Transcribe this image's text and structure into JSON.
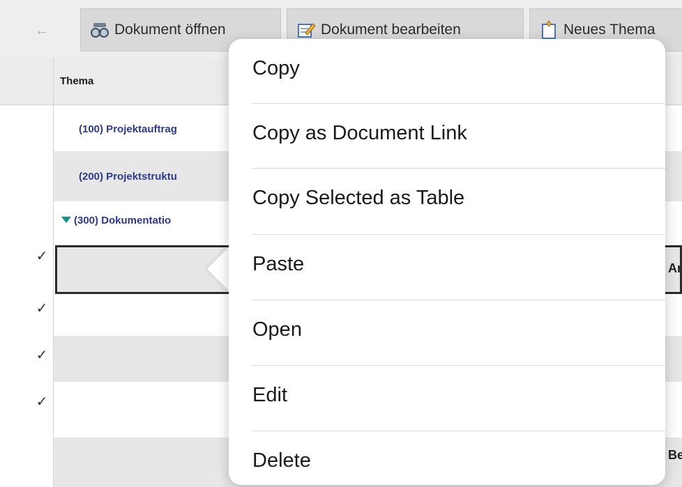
{
  "toolbar": {
    "back_icon": "back-arrow-icon",
    "buttons": [
      {
        "label": "Dokument öffnen",
        "icon": "glasses-icon"
      },
      {
        "label": "Dokument bearbeiten",
        "icon": "edit-note-icon"
      },
      {
        "label": "Neues Thema",
        "icon": "new-topic-icon"
      }
    ]
  },
  "table": {
    "column_header": "Thema",
    "rows": [
      {
        "text": "(100) Projektauftrag"
      },
      {
        "text": "(200) Projektstruktu"
      },
      {
        "text": "(300) Dokumentatio"
      }
    ],
    "row3_clip": "Ar",
    "row7_clip": "Be"
  },
  "context_menu": {
    "items": [
      "Copy",
      "Copy as Document Link",
      "Copy Selected as Table",
      "Paste",
      "Open",
      "Edit",
      "Delete"
    ]
  },
  "colors": {
    "link_blue": "#2d3a8c",
    "expand_teal": "#138f86"
  }
}
